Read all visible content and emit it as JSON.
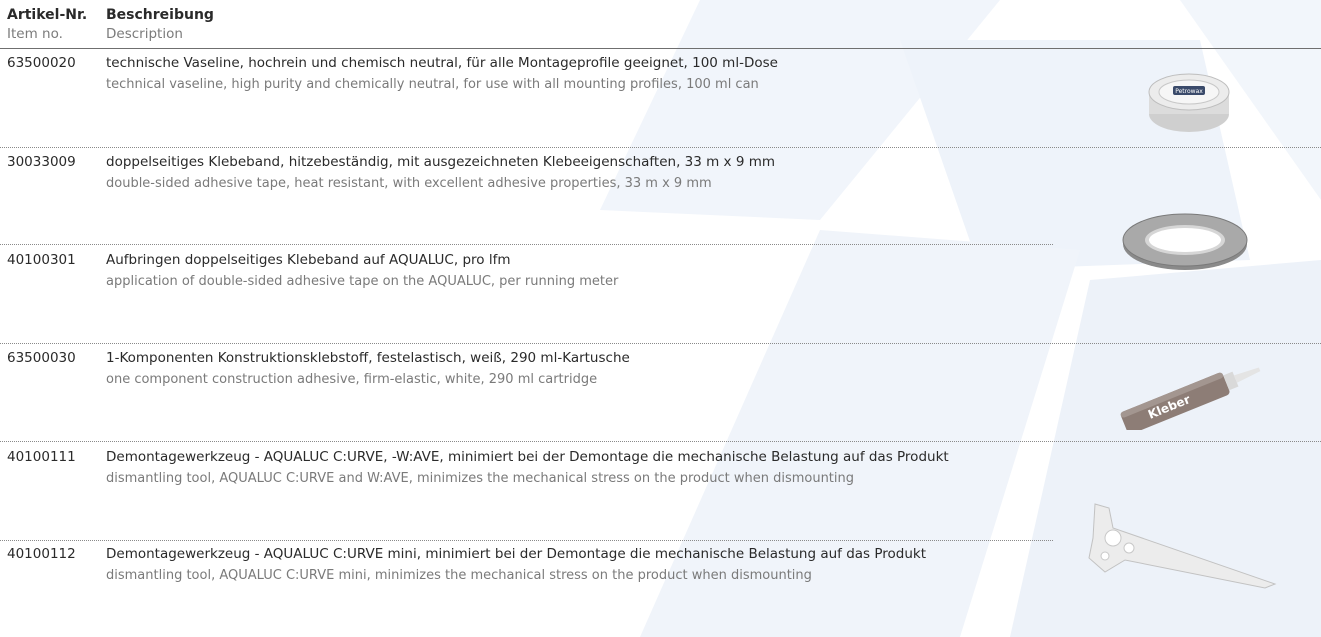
{
  "header": {
    "col1_de": "Artikel-Nr.",
    "col1_en": "Item no.",
    "col2_de": "Beschreibung",
    "col2_en": "Description"
  },
  "rows": [
    {
      "number": "63500020",
      "de": "technische Vaseline, hochrein und chemisch neutral, für alle Montageprofile geeignet, 100 ml-Dose",
      "en": "technical vaseline, high purity and chemically neutral, for use with all mounting profiles, 100 ml can"
    },
    {
      "number": "30033009",
      "de": "doppelseitiges Klebeband, hitzebeständig, mit ausgezeichneten Klebeeigenschaften, 33 m x 9 mm",
      "en": "double-sided adhesive tape, heat resistant, with excellent adhesive properties, 33 m x 9 mm"
    },
    {
      "number": "40100301",
      "de": "Aufbringen doppelseitiges Klebeband auf AQUALUC, pro lfm",
      "en": "application of double-sided adhesive tape on the AQUALUC, per running meter"
    },
    {
      "number": "63500030",
      "de": "1-Komponenten Konstruktionsklebstoff, festelastisch, weiß, 290 ml-Kartusche",
      "en": "one component construction adhesive, firm-elastic, white, 290 ml cartridge"
    },
    {
      "number": "40100111",
      "de": "Demontagewerkzeug - AQUALUC C:URVE, -W:AVE, minimiert bei der Demontage die mechanische Belastung auf das Produkt",
      "en": "dismantling tool, AQUALUC C:URVE and W:AVE, minimizes the mechanical stress on the product when dismounting"
    },
    {
      "number": "40100112",
      "de": "Demontagewerkzeug - AQUALUC C:URVE mini, minimiert bei der Demontage die mechanische Belastung auf das Produkt",
      "en": "dismantling tool, AQUALUC C:URVE mini, minimizes the mechanical stress on the product when dismounting"
    }
  ],
  "images": {
    "vaseline_label": "Petrowax",
    "cartridge_label": "Kleber"
  },
  "colors": {
    "watermark": "#eef3fb",
    "rule": "#6f6f6f",
    "secondary_text": "#7a7a7a"
  }
}
